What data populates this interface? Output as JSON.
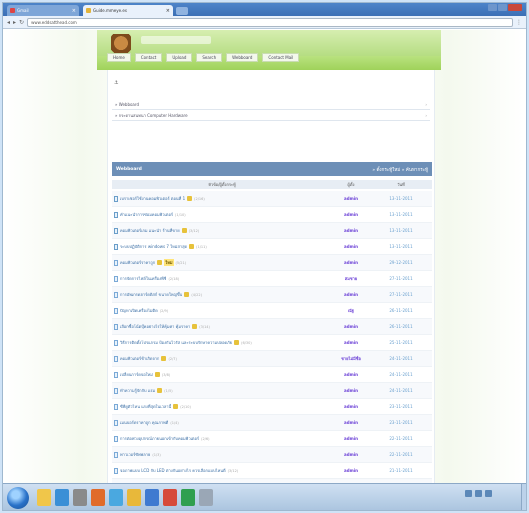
{
  "browser": {
    "tabs": [
      {
        "label": "Gmail",
        "active": false
      },
      {
        "label": "Guide.mmeye.es",
        "active": true
      }
    ],
    "url": "www.eddsatthead.com"
  },
  "site": {
    "nav": [
      "Home",
      "Contact",
      "Upload",
      "Search",
      "Webboard",
      "Contact Mail"
    ],
    "breadcrumbs": [
      "» Webboard",
      "» กระดานสนทนา Computer Hardware"
    ],
    "table_title": "Webboard",
    "table_actions": "» ตั้งกระทู้ใหม่  » ค้นหากระทู้",
    "columns": [
      "หัวข้อ/ผู้ตั้งกระทู้",
      "ผู้ตั้ง",
      "วันที่"
    ],
    "rows": [
      {
        "title": "เบราเซอร์ใช้งานคอมพิวเตอร์ ตอนที่ 1",
        "hot": true,
        "count": "(2/16)",
        "user": "admin",
        "date": "13-11-2011"
      },
      {
        "title": "คำแนะนำการซ่อมคอมพิวเตอร์",
        "hot": false,
        "count": "(1/10)",
        "user": "admin",
        "date": "13-11-2011"
      },
      {
        "title": "คอมพิวเตอร์เกม แนะนำ ร้านที่ขาย",
        "hot": true,
        "count": "(3/12)",
        "user": "admin",
        "date": "13-11-2011"
      },
      {
        "title": "ระบบปฏิบัติการ windows 7 ใหม่ล่าสุด",
        "hot": true,
        "count": "(1/11)",
        "user": "admin",
        "date": "13-11-2011"
      },
      {
        "title": "คอมพิวเตอร์ราคาถูก",
        "hot": true,
        "badge": "ใหม่",
        "count": "(5/21)",
        "user": "admin",
        "date": "29-12-2011"
      },
      {
        "title": "การจัดการไฟล์ในเครื่องพีซี",
        "hot": false,
        "count": "(2/18)",
        "user": "สมชาย",
        "date": "27-11-2011"
      },
      {
        "title": "การอัพเกรดฮาร์ดดิสก์ ขนาดใหญ่ขึ้น",
        "hot": true,
        "count": "(4/22)",
        "user": "admin",
        "date": "27-11-2011"
      },
      {
        "title": "ปัญหาเปิดเครื่องไม่ติด",
        "hot": false,
        "count": "(2/9)",
        "user": "ณัฐ",
        "date": "26-11-2011"
      },
      {
        "title": "เลือกซื้อโน้ตบุ๊คอย่างไรให้คุ้มค่า คุ้มราคา",
        "hot": true,
        "count": "(3/14)",
        "user": "admin",
        "date": "26-11-2011"
      },
      {
        "title": "วิธีการติดตั้งโปรแกรม ป้องกันไวรัส และระบบรักษาความปลอดภัย",
        "hot": true,
        "count": "(6/30)",
        "user": "admin",
        "date": "25-11-2011"
      },
      {
        "title": "คอมพิวเตอร์ช้าเกิดจาก",
        "hot": true,
        "count": "(2/7)",
        "user": "ชายไม่มีชื่อ",
        "date": "24-11-2011"
      },
      {
        "title": "เปลี่ยนการ์ดจอใหม่",
        "hot": true,
        "count": "(3/8)",
        "user": "admin",
        "date": "24-11-2011"
      },
      {
        "title": "ทำความรู้จักกับ แรม",
        "hot": true,
        "count": "(1/5)",
        "user": "admin",
        "date": "24-11-2011"
      },
      {
        "title": "ซีพียูตัวไหน แรงที่สุดในเวลานี้",
        "hot": true,
        "count": "(2/10)",
        "user": "admin",
        "date": "23-11-2011"
      },
      {
        "title": "เมนบอร์ดราคาถูก คุณภาพดี",
        "hot": false,
        "count": "(1/4)",
        "user": "admin",
        "date": "23-11-2011"
      },
      {
        "title": "การต่อพ่วงอุปกรณ์ภายนอกเข้ากับคอมพิวเตอร์",
        "hot": false,
        "count": "(2/6)",
        "user": "admin",
        "date": "22-11-2011"
      },
      {
        "title": "พาวเวอร์ซัพพลาย",
        "hot": false,
        "count": "(1/3)",
        "user": "admin",
        "date": "22-11-2011"
      },
      {
        "title": "จอภาพแบบ LCD กับ LED ต่างกันอย่างไร ควรเลือกแบบไหนดี",
        "hot": false,
        "count": "(3/12)",
        "user": "admin",
        "date": "21-11-2011"
      },
      {
        "title": "การบำรุงรักษาเครื่องพิมพ์",
        "hot": false,
        "count": "(1/6)",
        "user": "ธ",
        "date": "21-11-2011"
      },
      {
        "title": "การระบายความร้อนคอมพิวเตอร์",
        "hot": false,
        "count": "(2/5)",
        "user": "ทั่วไปก็ได้นะ",
        "date": "20-11-2011"
      }
    ]
  },
  "colors": {
    "table_header": "#6d8fb7",
    "link": "#3a6ea5",
    "user": "#6a3fd6",
    "date": "#6aa0cf"
  }
}
